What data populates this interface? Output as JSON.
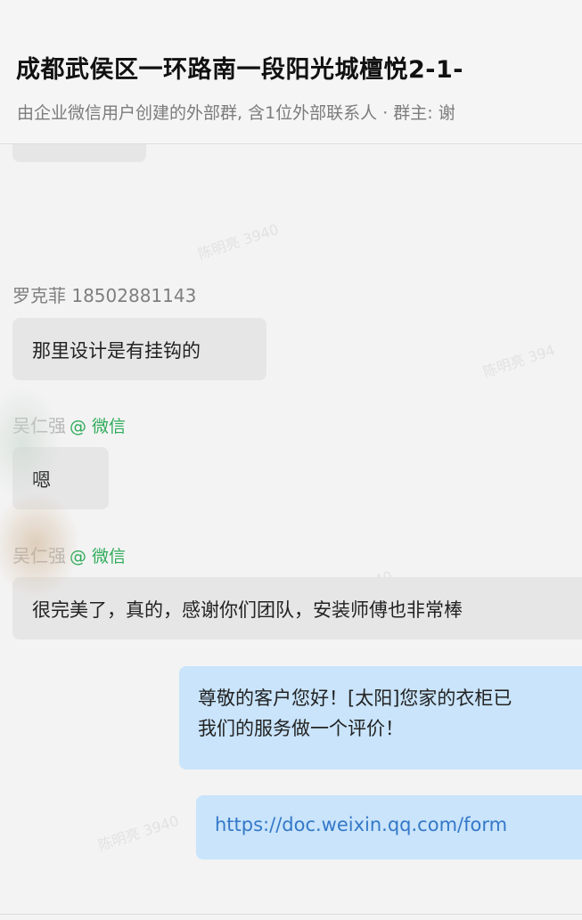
{
  "header": {
    "title": "成都武侯区一环路南一段阳光城檀悦2-1-",
    "subtitle": "由企业微信用户创建的外部群, 含1位外部联系人 · 群主: 谢"
  },
  "watermark_text": [
    "陈明亮 3940",
    "陈明亮 394",
    "陈明亮 3940",
    "40"
  ],
  "messages": [
    {
      "sender": "罗克菲 18502881143",
      "text": "那里设计是有挂钩的"
    },
    {
      "sender": "吴仁强",
      "source_tag": "@ 微信",
      "text": "嗯"
    },
    {
      "sender": "吴仁强",
      "source_tag": "@ 微信",
      "text": "很完美了，真的，感谢你们团队，安装师傅也非常棒"
    },
    {
      "line1": "尊敬的客户您好！[太阳]您家的衣柜已",
      "line2": "我们的服务做一个评价！"
    },
    {
      "link": "https://doc.weixin.qq.com/form"
    }
  ]
}
